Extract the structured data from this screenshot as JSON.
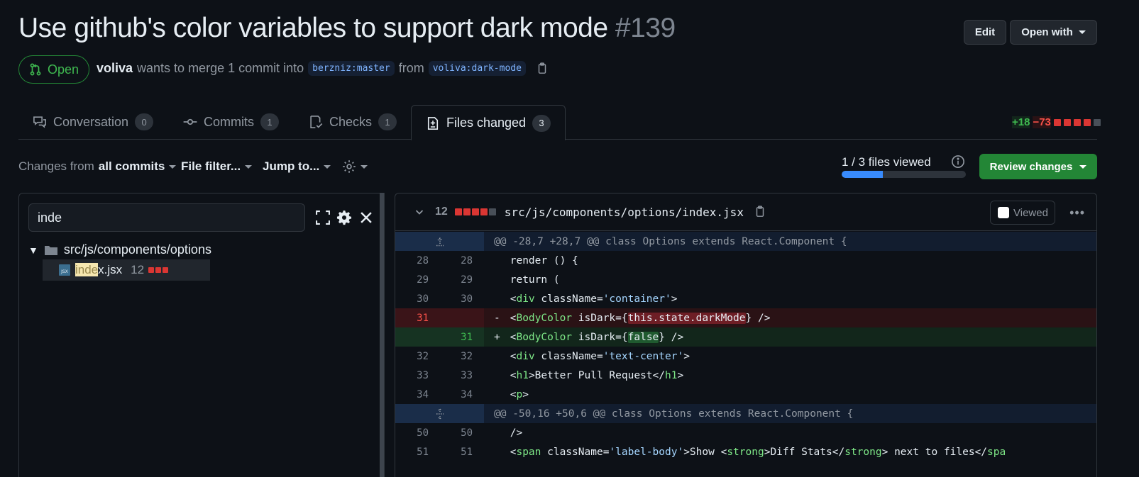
{
  "pr": {
    "title_text": "Use github's color variables to support dark mode",
    "number": "#139",
    "state": "Open",
    "author": "voliva",
    "merge_text": "wants to merge 1 commit into",
    "base_branch": "berzniz:master",
    "from_text": "from",
    "head_branch": "voliva:dark-mode"
  },
  "header_actions": {
    "edit_label": "Edit",
    "open_with_label": "Open with"
  },
  "tabs": [
    {
      "label": "Conversation",
      "count": "0",
      "icon": "comment-discussion-icon"
    },
    {
      "label": "Commits",
      "count": "1",
      "icon": "git-commit-icon"
    },
    {
      "label": "Checks",
      "count": "1",
      "icon": "checklist-icon"
    },
    {
      "label": "Files changed",
      "count": "3",
      "icon": "file-diff-icon",
      "selected": true
    }
  ],
  "diffstat": {
    "additions": "+18",
    "deletions": "−73"
  },
  "toolbar": {
    "changes_from_prefix": "Changes from",
    "changes_from_value": "all commits",
    "file_filter": "File filter...",
    "jump_to": "Jump to...",
    "files_viewed": "1 / 3 files viewed",
    "files_viewed_fraction": 0.333,
    "review_changes": "Review changes"
  },
  "file_tree": {
    "filter_value": "inde",
    "folder": "src/js/components/options",
    "file": {
      "match": "inde",
      "rest": "x.jsx",
      "changes": "12",
      "icon": "jsx-file-icon"
    }
  },
  "diff_file": {
    "changes": "12",
    "path": "src/js/components/options/index.jsx",
    "viewed_label": "Viewed"
  },
  "diff_lines": [
    {
      "type": "hunk",
      "text": "@@ -28,7 +28,7 @@ class Options extends React.Component {"
    },
    {
      "type": "ctx",
      "old": "28",
      "new": "28",
      "text": "    render () {"
    },
    {
      "type": "ctx",
      "old": "29",
      "new": "29",
      "text": "      return ("
    },
    {
      "type": "ctx",
      "old": "30",
      "new": "30",
      "text": "        <div className='container'>"
    },
    {
      "type": "del",
      "old": "31",
      "new": "",
      "text": "          <BodyColor isDark={this.state.darkMode} />"
    },
    {
      "type": "add",
      "old": "",
      "new": "31",
      "text": "          <BodyColor isDark={false} />"
    },
    {
      "type": "ctx",
      "old": "32",
      "new": "32",
      "text": "          <div className='text-center'>"
    },
    {
      "type": "ctx",
      "old": "33",
      "new": "33",
      "text": "            <h1>Better Pull Request</h1>"
    },
    {
      "type": "ctx",
      "old": "34",
      "new": "34",
      "text": "            <p>"
    },
    {
      "type": "hunk",
      "text": "@@ -50,16 +50,6 @@ class Options extends React.Component {"
    },
    {
      "type": "ctx",
      "old": "50",
      "new": "50",
      "text": "              />"
    },
    {
      "type": "ctx",
      "old": "51",
      "new": "51",
      "text": "              <span className='label-body'>Show <strong>Diff Stats</strong> next to files</spa"
    }
  ],
  "colors": {
    "accent_green": "#238636",
    "add_text": "#3fb950",
    "del_text": "#f85149",
    "link_blue": "#388bfd",
    "bg": "#0d1117"
  }
}
